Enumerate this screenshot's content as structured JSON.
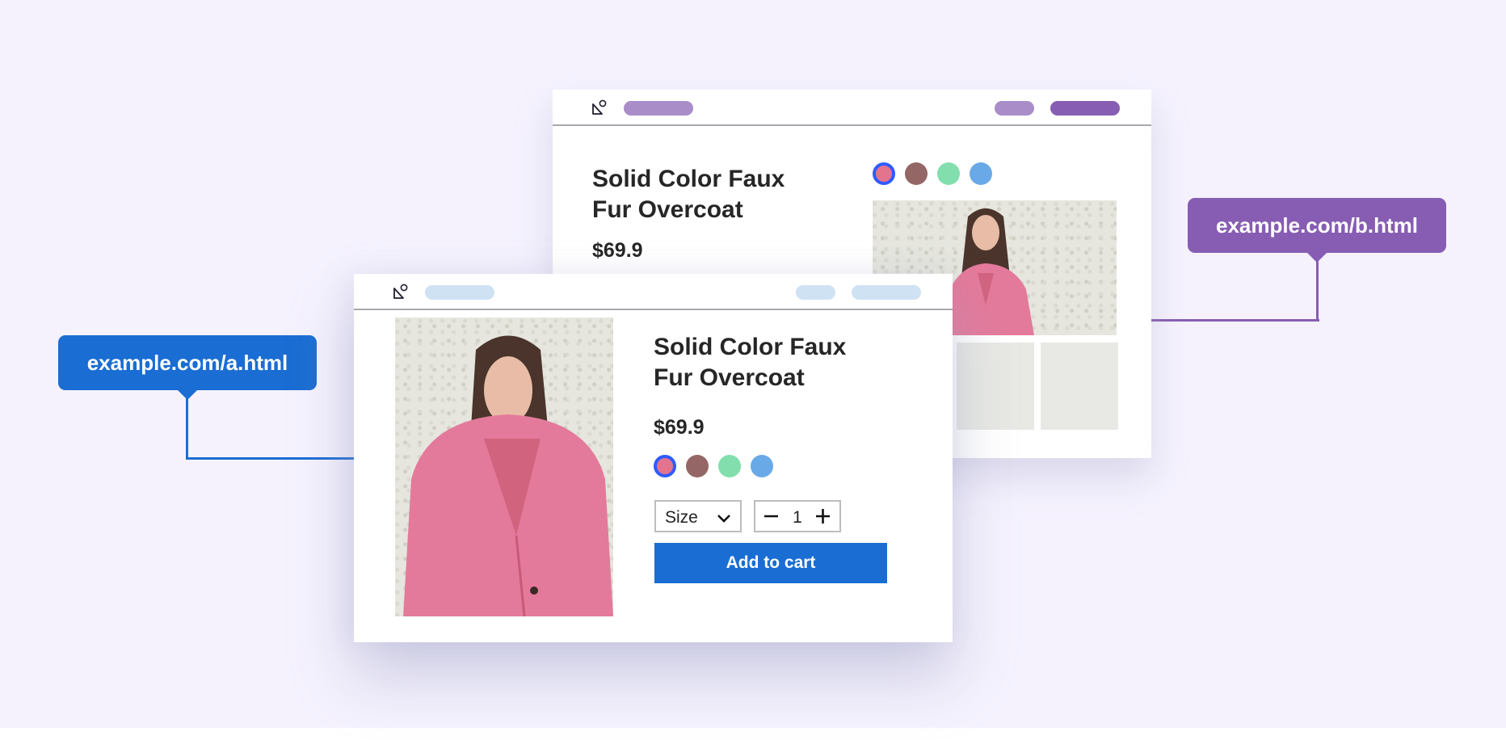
{
  "colors": {
    "background": "#f5f2fe",
    "variant_a_accent": "#1a6dd3",
    "variant_b_accent": "#875db3",
    "variant_a_pill": "#cfe2f3",
    "variant_b_pill_light": "#a98dc9",
    "variant_b_pill_dark": "#875db3",
    "selected_ring": "#2f5bff"
  },
  "variant_a": {
    "url_label": "example.com/a.html",
    "header": {
      "logo_icon": "shapes-icon"
    },
    "product": {
      "title_line1": "Solid Color Faux",
      "title_line2": "Fur Overcoat",
      "price": "$69.9",
      "image_alt": "Woman wearing pink faux fur overcoat",
      "swatches": [
        {
          "name": "pink",
          "color": "#e4738e",
          "selected": true
        },
        {
          "name": "brown",
          "color": "#946766",
          "selected": false
        },
        {
          "name": "green",
          "color": "#82dfad",
          "selected": false
        },
        {
          "name": "blue",
          "color": "#6aa9e8",
          "selected": false
        }
      ],
      "size_select": {
        "label": "Size",
        "icon": "chevron-down-icon"
      },
      "quantity": {
        "value": "1",
        "minus_icon": "minus-icon",
        "plus_icon": "plus-icon"
      },
      "add_to_cart_label": "Add to cart"
    }
  },
  "variant_b": {
    "url_label": "example.com/b.html",
    "header": {
      "logo_icon": "shapes-icon"
    },
    "product": {
      "title_line1": "Solid Color Faux",
      "title_line2": "Fur Overcoat",
      "price": "$69.9",
      "image_alt": "Woman wearing pink faux fur overcoat",
      "swatches": [
        {
          "name": "pink",
          "color": "#e4738e",
          "selected": true
        },
        {
          "name": "brown",
          "color": "#946766",
          "selected": false
        },
        {
          "name": "green",
          "color": "#82dfad",
          "selected": false
        },
        {
          "name": "blue",
          "color": "#6aa9e8",
          "selected": false
        }
      ],
      "thumbnail_count": 3
    }
  }
}
